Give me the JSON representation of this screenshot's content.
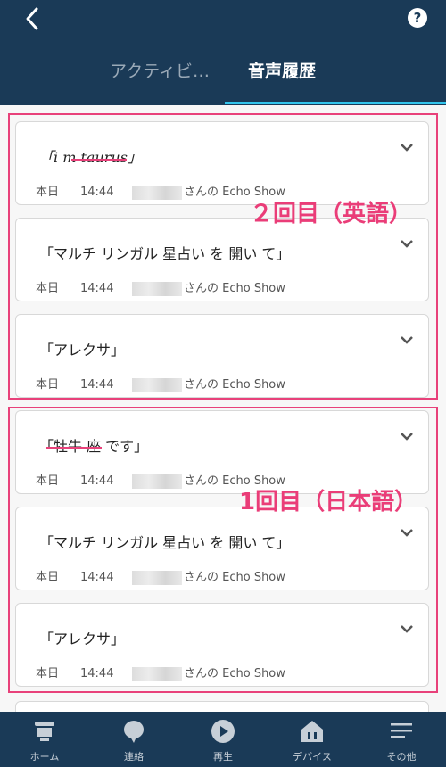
{
  "header": {
    "help_symbol": "?"
  },
  "tabs": [
    {
      "label": "アクティビ…"
    },
    {
      "label": "音声履歴"
    }
  ],
  "entries": [
    {
      "text": "「i m taurus」",
      "date": "本日",
      "time": "14:44",
      "device": "さんの Echo Show"
    },
    {
      "text": "「マルチ リンガル 星占い を 開い て」",
      "date": "本日",
      "time": "14:44",
      "device": "さんの Echo Show"
    },
    {
      "text": "「アレクサ」",
      "date": "本日",
      "time": "14:44",
      "device": "さんの Echo Show"
    },
    {
      "text": "「牡牛 座 です」",
      "date": "本日",
      "time": "14:44",
      "device": "さんの Echo Show"
    },
    {
      "text": "「マルチ リンガル 星占い を 開い て」",
      "date": "本日",
      "time": "14:44",
      "device": "さんの Echo Show"
    },
    {
      "text": "「アレクサ」",
      "date": "本日",
      "time": "14:44",
      "device": "さんの Echo Show"
    }
  ],
  "annotations": {
    "group1": "２回目（英語）",
    "group2": "1回目（日本語）",
    "color": "#ea3d78"
  },
  "tabbar": [
    {
      "label": "ホーム",
      "icon": "home-icon"
    },
    {
      "label": "連絡",
      "icon": "chat-bubble-icon"
    },
    {
      "label": "再生",
      "icon": "play-icon"
    },
    {
      "label": "デバイス",
      "icon": "devices-icon"
    },
    {
      "label": "その他",
      "icon": "menu-icon"
    }
  ],
  "colors": {
    "header": "#1a3a57",
    "accent": "#32c5ec"
  }
}
